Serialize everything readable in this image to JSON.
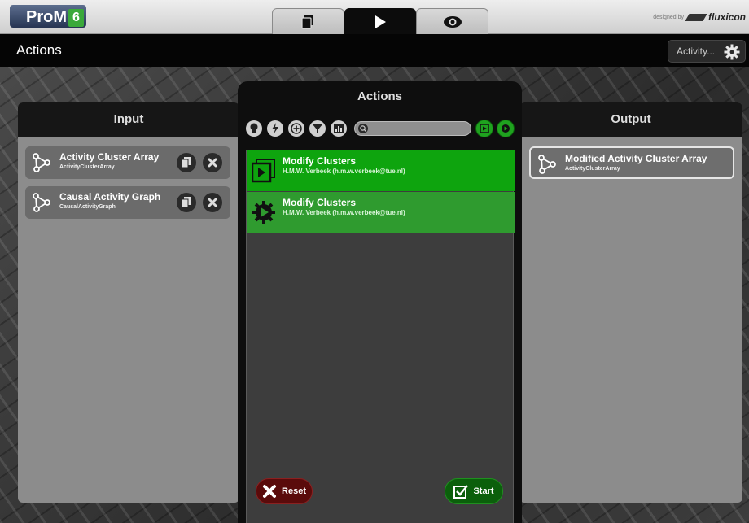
{
  "app": {
    "logo_text": "ProM",
    "logo_version": "6",
    "designed_by": "designed by",
    "brand": "fluxicon",
    "view_tabs": [
      {
        "icon": "workspace-icon"
      },
      {
        "icon": "play-icon"
      },
      {
        "icon": "eye-icon"
      }
    ]
  },
  "titlebar": {
    "title": "Actions",
    "activity_label": "Activity..."
  },
  "input": {
    "header": "Input",
    "items": [
      {
        "title": "Activity Cluster Array",
        "type": "ActivityClusterArray"
      },
      {
        "title": "Causal Activity Graph",
        "type": "CausalActivityGraph"
      }
    ]
  },
  "actions": {
    "header": "Actions",
    "search_placeholder": "",
    "items": [
      {
        "title": "Modify Clusters",
        "author": "H.M.W. Verbeek (h.m.w.verbeek@tue.nl)"
      },
      {
        "title": "Modify Clusters",
        "author": "H.M.W. Verbeek (h.m.w.verbeek@tue.nl)"
      }
    ],
    "reset_label": "Reset",
    "start_label": "Start"
  },
  "output": {
    "header": "Output",
    "items": [
      {
        "title": "Modified Activity Cluster Array",
        "type": "ActivityClusterArray"
      }
    ]
  },
  "colors": {
    "accent_green": "#0ea40e",
    "reset_red": "#5a0b0b"
  }
}
